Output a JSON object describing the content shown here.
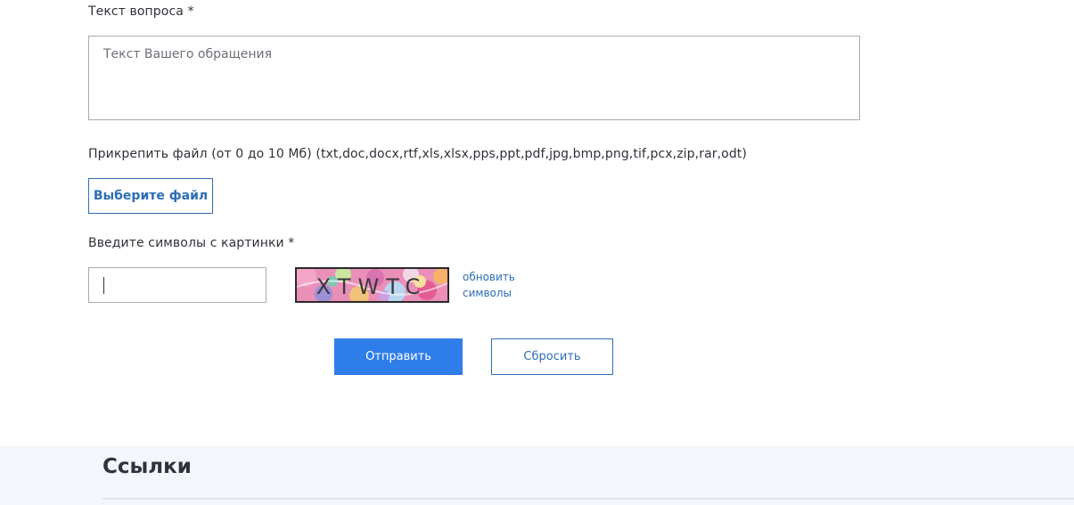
{
  "form": {
    "question_label": "Текст вопроса *",
    "question_placeholder": "Текст Вашего обращения",
    "question_value": "",
    "attach_label": "Прикрепить файл (от 0 до 10 Мб) (txt,doc,docx,rtf,xls,xlsx,pps,ppt,pdf,jpg,bmp,png,tif,pcx,zip,rar,odt)",
    "file_button_label": "Выберите файл",
    "captcha_label": "Введите символы с картинки *",
    "captcha_value": "",
    "captcha_image_text": "XTWTC",
    "refresh_captcha_label": "обновить символы",
    "submit_label": "Отправить",
    "reset_label": "Сбросить"
  },
  "links_section": {
    "title": "Ссылки"
  },
  "colors": {
    "accent": "#2f7de8",
    "link": "#2d6db5",
    "section_background": "#f3f6fa"
  }
}
